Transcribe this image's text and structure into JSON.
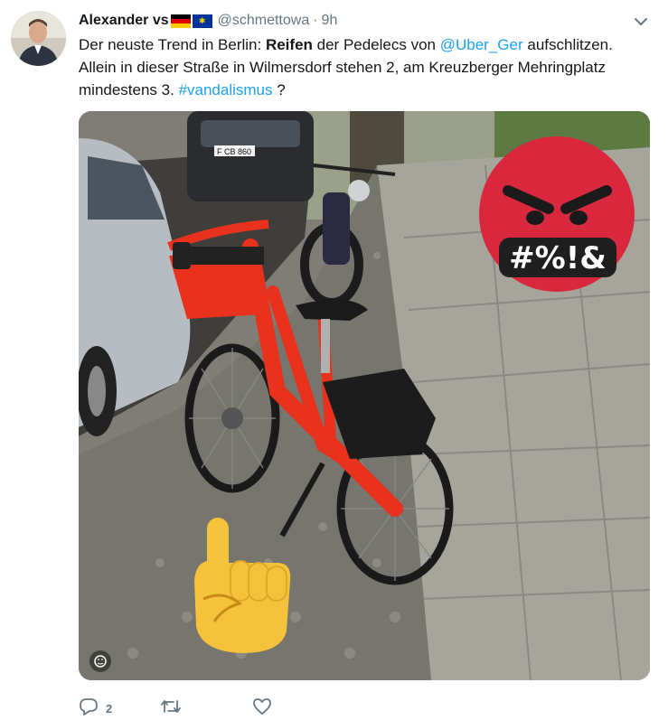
{
  "tweet": {
    "display_name": "Alexander vs",
    "handle": "@schmettowa",
    "separator": "·",
    "time": "9h",
    "text": {
      "part1": "Der neuste Trend in Berlin: ",
      "bold": "Reifen",
      "part2": " der Pedelecs von ",
      "mention": "@Uber_Ger",
      "part3": " aufschlitzen. Allein in dieser Straße in Wilmersdorf stehen 2, am Kreuzberger Mehringplatz mindestens 3. ",
      "hashtag": "#vandalismus",
      "part4": " ?"
    },
    "sticker_text": "#%!&",
    "license_plate": "F CB 860",
    "actions": {
      "reply_count": "2",
      "retweet_count": "",
      "like_count": ""
    }
  },
  "colors": {
    "link": "#1da1f2",
    "muted": "#657786",
    "bike_red": "#e8321e",
    "angry_red": "#d9283d",
    "emoji_yellow": "#f5c33b"
  },
  "icons": [
    "caret-down-icon",
    "reply-icon",
    "retweet-icon",
    "like-icon",
    "emoji-icon"
  ]
}
